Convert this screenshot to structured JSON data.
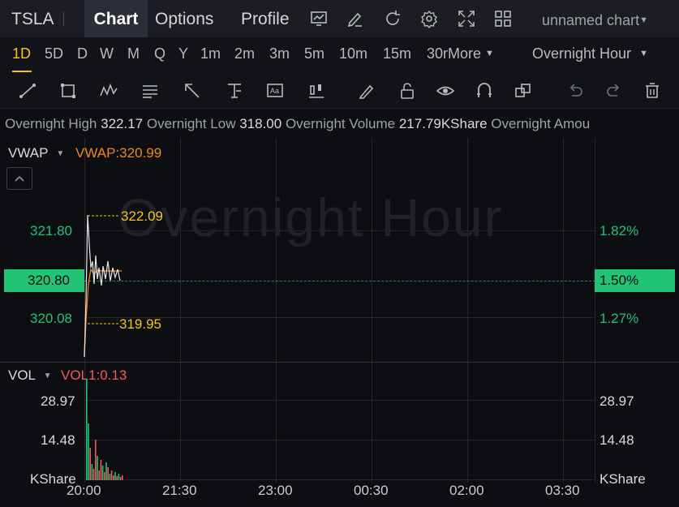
{
  "header": {
    "symbol": "TSLA",
    "tabs": [
      {
        "label": "Chart",
        "active": true
      },
      {
        "label": "Options",
        "active": false
      },
      {
        "label": "Profile",
        "active": false
      }
    ],
    "icons": [
      "chart-type-icon",
      "draw-icon",
      "refresh-icon",
      "settings-icon",
      "fullscreen-icon",
      "layout-icon"
    ],
    "chart_name": "unnamed chart"
  },
  "periods": {
    "items": [
      "1D",
      "5D",
      "D",
      "W",
      "M",
      "Q",
      "Y",
      "1m",
      "2m",
      "3m",
      "5m",
      "10m",
      "15m",
      "30m"
    ],
    "active": "1D",
    "more_label": "More",
    "session_label": "Overnight Hour"
  },
  "tools": [
    "trendline-icon",
    "rectangle-icon",
    "pattern-icon",
    "fib-icon",
    "arrow-icon",
    "measure-icon",
    "text-icon",
    "position-icon",
    "pencil-icon",
    "lock-icon",
    "eye-icon",
    "magnet-icon",
    "layers-icon",
    "undo-icon",
    "redo-icon",
    "trash-icon"
  ],
  "info": {
    "high_label": "Overnight High",
    "high_value": "322.17",
    "low_label": "Overnight Low",
    "low_value": "318.00",
    "volume_label": "Overnight Volume",
    "volume_value": "217.79KShare",
    "amount_label": "Overnight Amou"
  },
  "main_pane": {
    "indicator": "VWAP",
    "indicator_value": "VWAP:320.99",
    "watermark": "Overnight Hour",
    "high_marker": "322.09",
    "low_marker": "319.95",
    "left_ticks": [
      "321.80",
      "320.08"
    ],
    "right_ticks": [
      "1.82%",
      "1.27%"
    ],
    "current_price": "320.80",
    "current_pct": "1.50%"
  },
  "volume_pane": {
    "indicator": "VOL",
    "indicator_value": "VOL1:0.13",
    "left_ticks": [
      "28.97",
      "14.48",
      "KShare"
    ],
    "right_ticks": [
      "28.97",
      "14.48",
      "KShare"
    ]
  },
  "x_axis": [
    "20:00",
    "21:30",
    "23:00",
    "00:30",
    "02:00",
    "03:30"
  ],
  "colors": {
    "up": "#21c375",
    "down": "#f05a5a",
    "accent": "#f5c518",
    "vwap": "#f0871a",
    "bg": "#0d0e12"
  }
}
